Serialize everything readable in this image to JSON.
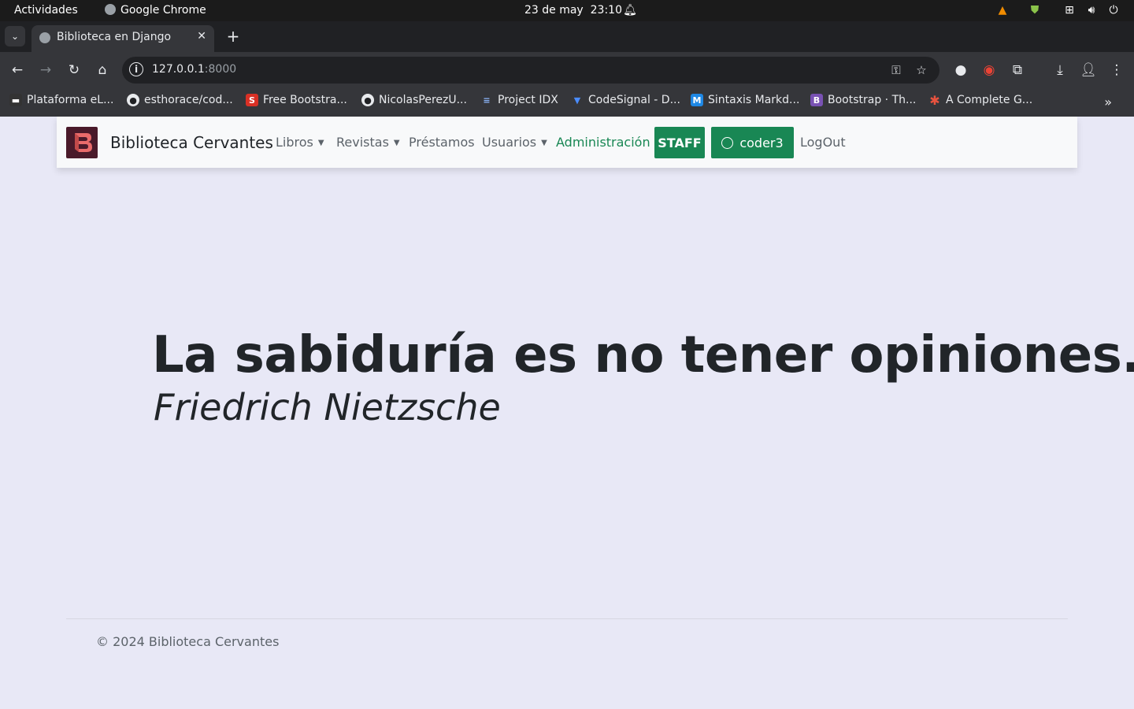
{
  "system_bar": {
    "activities": "Actividades",
    "app_name": "Google Chrome",
    "date": "23 de may",
    "time": "23:10"
  },
  "browser": {
    "tab_title": "Biblioteca en Django",
    "url_host": "127.0.0.1",
    "url_port": ":8000",
    "bookmarks": [
      {
        "label": "Plataforma eL...",
        "icon": "site-icon",
        "color": "#333333"
      },
      {
        "label": "esthorace/cod...",
        "icon": "github-icon",
        "color": "#35363a"
      },
      {
        "label": "Free Bootstra...",
        "icon": "s-icon",
        "color": "#d93025"
      },
      {
        "label": "NicolasPerezU...",
        "icon": "github-icon",
        "color": "#35363a"
      },
      {
        "label": "Project IDX",
        "icon": "idx-icon",
        "color": "#4285f4"
      },
      {
        "label": "CodeSignal - D...",
        "icon": "codesignal-icon",
        "color": "#1a73e8"
      },
      {
        "label": "Sintaxis Markd...",
        "icon": "markdown-icon",
        "color": "#1e88e5"
      },
      {
        "label": "Bootstrap · Th...",
        "icon": "bootstrap-icon",
        "color": "#7952b3"
      },
      {
        "label": "A Complete G...",
        "icon": "asterisk-icon",
        "color": "#e8533f"
      }
    ]
  },
  "navbar": {
    "brand": "Biblioteca Cervantes",
    "links": {
      "libros": "Libros",
      "revistas": "Revistas",
      "prestamos": "Préstamos",
      "usuarios": "Usuarios",
      "admin": "Administración",
      "logout": "LogOut"
    },
    "staff_badge": "STAFF",
    "user": "coder3",
    "accent": "#198754"
  },
  "main": {
    "quote": "La sabiduría es no tener opiniones.",
    "author": "Friedrich Nietzsche"
  },
  "footer": {
    "text": "© 2024 Biblioteca Cervantes"
  }
}
